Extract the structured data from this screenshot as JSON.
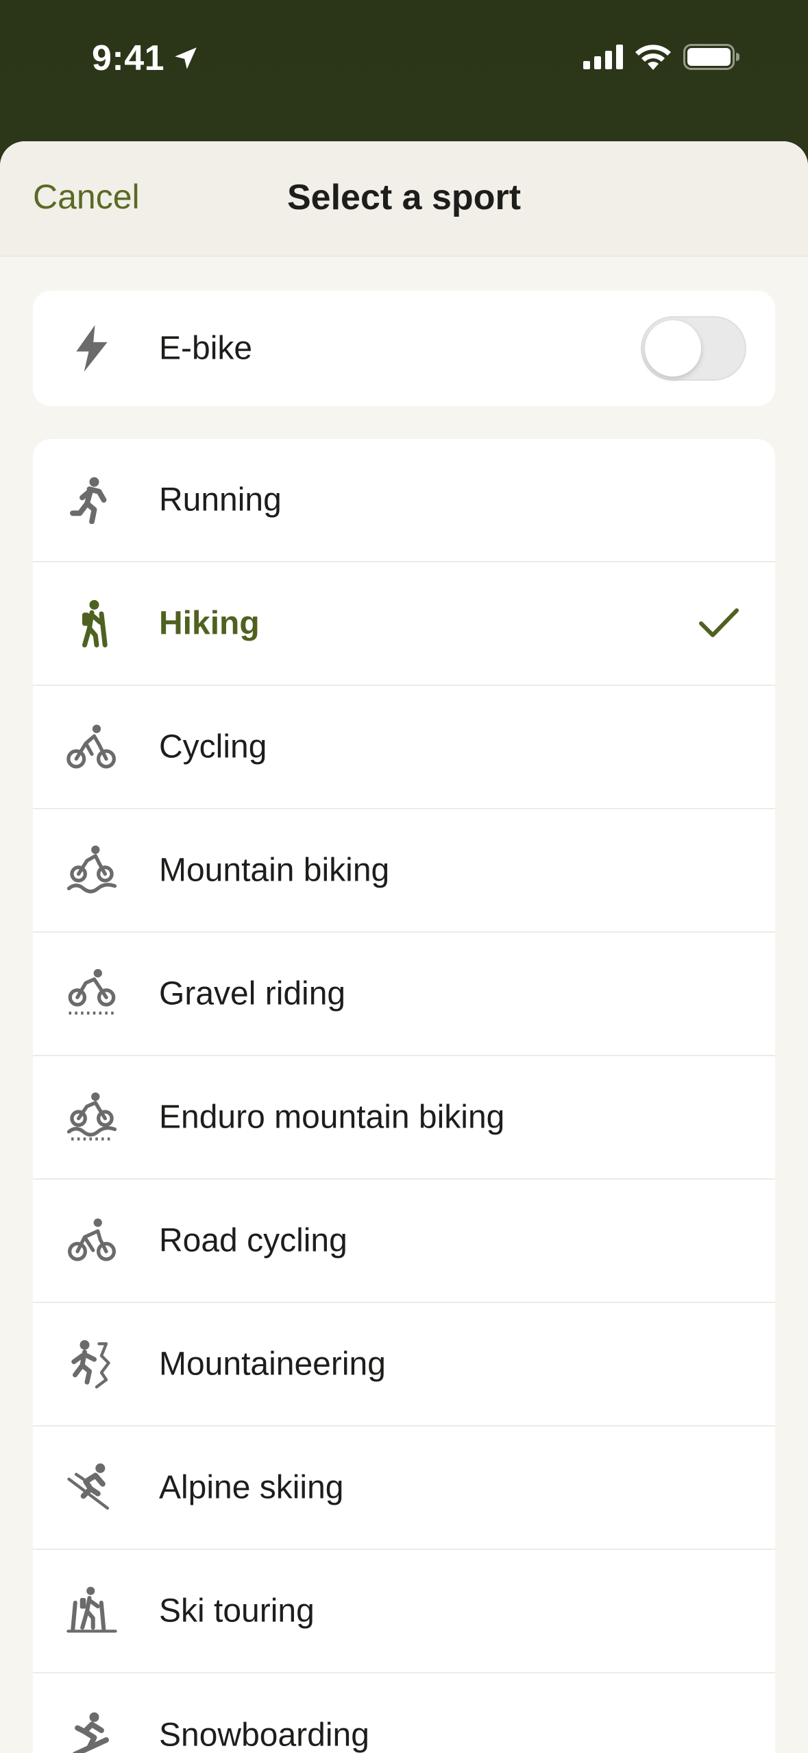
{
  "status_bar": {
    "time": "9:41"
  },
  "header": {
    "cancel_label": "Cancel",
    "title": "Select a sport"
  },
  "ebike": {
    "label": "E-bike",
    "icon": "lightning-icon",
    "toggle_on": false
  },
  "sports": [
    {
      "label": "Running",
      "icon": "running-icon",
      "selected": false
    },
    {
      "label": "Hiking",
      "icon": "hiking-icon",
      "selected": true
    },
    {
      "label": "Cycling",
      "icon": "cycling-icon",
      "selected": false
    },
    {
      "label": "Mountain biking",
      "icon": "mountain-biking-icon",
      "selected": false
    },
    {
      "label": "Gravel riding",
      "icon": "gravel-riding-icon",
      "selected": false
    },
    {
      "label": "Enduro mountain biking",
      "icon": "enduro-biking-icon",
      "selected": false
    },
    {
      "label": "Road cycling",
      "icon": "road-cycling-icon",
      "selected": false
    },
    {
      "label": "Mountaineering",
      "icon": "mountaineering-icon",
      "selected": false
    },
    {
      "label": "Alpine skiing",
      "icon": "alpine-skiing-icon",
      "selected": false
    },
    {
      "label": "Ski touring",
      "icon": "ski-touring-icon",
      "selected": false
    },
    {
      "label": "Snowboarding",
      "icon": "snowboarding-icon",
      "selected": false
    }
  ],
  "colors": {
    "accent": "#5a6a25",
    "selected_text": "#4f6120",
    "icon_gray": "#6b6b6b",
    "header_bg": "#2b3518"
  }
}
